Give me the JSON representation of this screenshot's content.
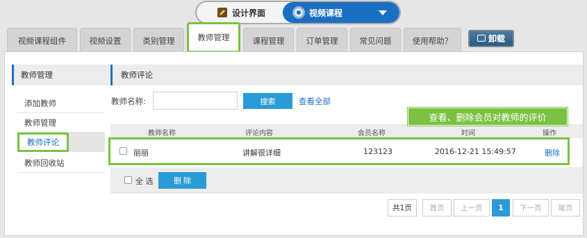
{
  "top_switch": {
    "left_label": "设计界面",
    "left_icon": "pencil-icon",
    "right_label": "视频课程",
    "right_icon": "gear-icon"
  },
  "tabs": [
    {
      "label": "视频课程组件"
    },
    {
      "label": "视频设置"
    },
    {
      "label": "类别管理"
    },
    {
      "label": "教师管理",
      "active": true
    },
    {
      "label": "课程管理"
    },
    {
      "label": "订单管理"
    },
    {
      "label": "常见问题"
    },
    {
      "label": "使用帮助？"
    }
  ],
  "uninstall_label": "卸载",
  "sidebar": {
    "title": "教师管理",
    "items": [
      {
        "label": "添加教师"
      },
      {
        "label": "教师管理"
      },
      {
        "label": "教师评论",
        "active": true
      },
      {
        "label": "教师回收站"
      }
    ]
  },
  "content": {
    "title": "教师评论",
    "search_label": "教师名称:",
    "search_value": "",
    "search_button": "搜索",
    "view_all": "查看全部"
  },
  "annotation": "查看、删除会员对教师的评价",
  "table": {
    "columns": [
      "教师名称",
      "评论内容",
      "会员名称",
      "时间",
      "操作"
    ],
    "rows": [
      {
        "teacher": "丽丽",
        "comment": "讲解很详细",
        "member": "123123",
        "time": "2016-12-21 15:49:57",
        "action": "删除"
      }
    ]
  },
  "bulk": {
    "select_all": "全 选",
    "delete": "删 除"
  },
  "pagination": {
    "total": "共1页",
    "first": "首页",
    "prev": "上一页",
    "current": "1",
    "next": "下一页",
    "last": "尾页"
  },
  "colors": {
    "accent_blue": "#1a6fc4",
    "button_blue": "#2a9bd6",
    "highlight_green": "#7ac142"
  }
}
